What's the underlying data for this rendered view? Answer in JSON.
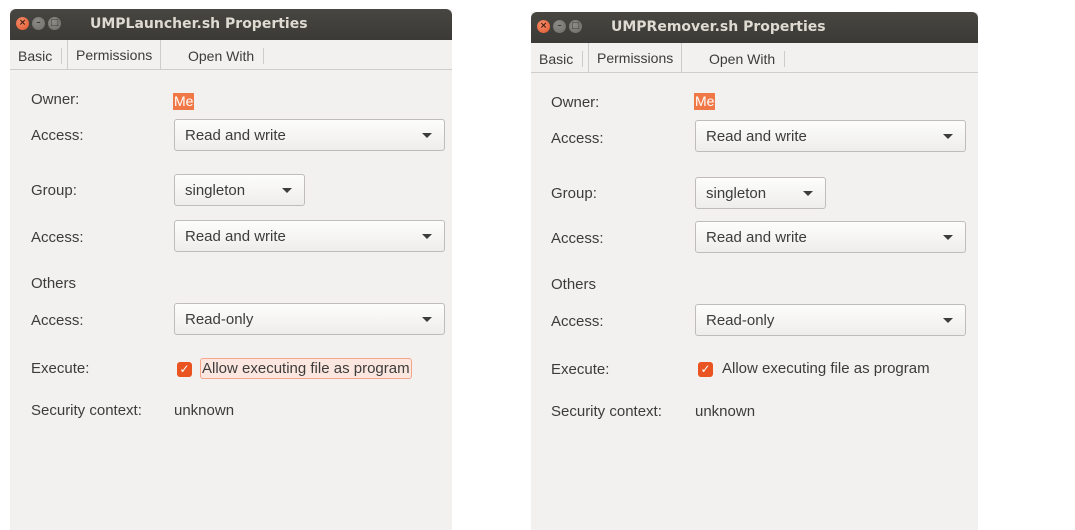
{
  "windows": [
    {
      "title": "UMPLauncher.sh Properties",
      "tabs": [
        "Basic",
        "Permissions",
        "Open With"
      ],
      "owner_label": "Owner:",
      "owner_value": "Me",
      "owner_access_label": "Access:",
      "owner_access_value": "Read and write",
      "group_label": "Group:",
      "group_value": "singleton",
      "group_access_label": "Access:",
      "group_access_value": "Read and write",
      "others_label": "Others",
      "others_access_label": "Access:",
      "others_access_value": "Read-only",
      "execute_label": "Execute:",
      "execute_checkbox_label": "Allow executing file as program",
      "execute_checked": true,
      "security_label": "Security context:",
      "security_value": "unknown"
    },
    {
      "title": "UMPRemover.sh Properties",
      "tabs": [
        "Basic",
        "Permissions",
        "Open With"
      ],
      "owner_label": "Owner:",
      "owner_value": "Me",
      "owner_access_label": "Access:",
      "owner_access_value": "Read and write",
      "group_label": "Group:",
      "group_value": "singleton",
      "group_access_label": "Access:",
      "group_access_value": "Read and write",
      "others_label": "Others",
      "others_access_label": "Access:",
      "others_access_value": "Read-only",
      "execute_label": "Execute:",
      "execute_checkbox_label": "Allow executing file as program",
      "execute_checked": true,
      "security_label": "Security context:",
      "security_value": "unknown"
    }
  ],
  "colors": {
    "accent": "#e95420",
    "titlebar": "#3c3b37",
    "window_bg": "#f2f1f0"
  }
}
